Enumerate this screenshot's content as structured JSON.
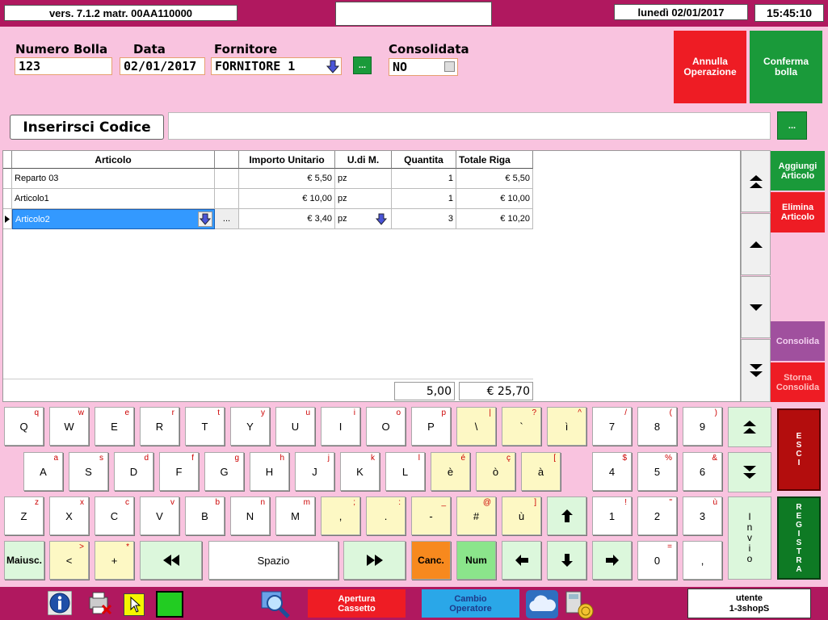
{
  "top": {
    "version": "vers. 7.1.2 matr. 00AA110000",
    "date": "lunedì 02/01/2017",
    "time": "15:45:10"
  },
  "form": {
    "numero_label": "Numero Bolla",
    "numero_value": "123",
    "data_label": "Data",
    "data_value": "02/01/2017",
    "fornitore_label": "Fornitore",
    "fornitore_value": "FORNITORE 1",
    "dots": "...",
    "consolidata_label": "Consolidata",
    "consolidata_value": "NO"
  },
  "buttons": {
    "annulla": "Annulla\nOperazione",
    "conferma": "Conferma\nbolla",
    "inserisci": "Inserirsci Codice",
    "aggiungi": "Aggiungi\nArticolo",
    "elimina": "Elimina\nArticolo",
    "consolida": "Consolida",
    "storna": "Storna\nConsolida",
    "esci": "E\nS\nC\nI",
    "registra": "R\nE\nG\nI\nS\nT\nR\nA",
    "invio": "I\nn\nv\ni\no",
    "colors": {
      "green": "#1a9a3a",
      "red": "#ee1c24",
      "purple": "#a0509e",
      "darkred": "#b30d0d",
      "darkgreen": "#0e7a24"
    }
  },
  "table": {
    "headers": [
      "Articolo",
      "",
      "Importo Unitario",
      "U.di M.",
      "Quantita",
      "Totale Riga"
    ],
    "rows": [
      [
        "Reparto 03",
        "",
        "€ 5,50",
        "pz",
        "1",
        "€ 5,50"
      ],
      [
        "Articolo1",
        "",
        "€ 10,00",
        "pz",
        "1",
        "€ 10,00"
      ],
      [
        "Articolo2",
        "...",
        "€ 3,40",
        "pz",
        "3",
        "€ 10,20"
      ]
    ],
    "total_qty": "5,00",
    "total_amount": "€ 25,70"
  },
  "keyboard": {
    "row1": [
      [
        "Q",
        "q"
      ],
      [
        "W",
        "w"
      ],
      [
        "E",
        "e"
      ],
      [
        "R",
        "r"
      ],
      [
        "T",
        "t"
      ],
      [
        "Y",
        "y"
      ],
      [
        "U",
        "u"
      ],
      [
        "I",
        "i"
      ],
      [
        "O",
        "o"
      ],
      [
        "P",
        "p"
      ],
      [
        "\\",
        "|"
      ],
      [
        "`",
        "?"
      ],
      [
        "ì",
        "^"
      ],
      [
        "7",
        "/"
      ],
      [
        "8",
        "("
      ],
      [
        "9",
        ")"
      ]
    ],
    "row2": [
      [
        "A",
        "a"
      ],
      [
        "S",
        "s"
      ],
      [
        "D",
        "d"
      ],
      [
        "F",
        "f"
      ],
      [
        "G",
        "g"
      ],
      [
        "H",
        "h"
      ],
      [
        "J",
        "j"
      ],
      [
        "K",
        "k"
      ],
      [
        "L",
        "l"
      ],
      [
        "è",
        "é"
      ],
      [
        "ò",
        "ç"
      ],
      [
        "à",
        "["
      ],
      [
        "4",
        "$"
      ],
      [
        "5",
        "%"
      ],
      [
        "6",
        "&"
      ]
    ],
    "row3": [
      [
        "Z",
        "z"
      ],
      [
        "X",
        "x"
      ],
      [
        "C",
        "c"
      ],
      [
        "V",
        "v"
      ],
      [
        "B",
        "b"
      ],
      [
        "N",
        "n"
      ],
      [
        "M",
        "m"
      ],
      [
        ",",
        ";"
      ],
      [
        ".",
        ":"
      ],
      [
        "-",
        "_"
      ],
      [
        "#",
        "@"
      ],
      [
        "ù",
        "]"
      ],
      [
        "1",
        "!"
      ],
      [
        "2",
        "\""
      ],
      [
        "3",
        "ù"
      ]
    ],
    "row4": {
      "maiusc": "Maiusc.",
      "lt": "<",
      "lt_sub": ">",
      "plus": "+",
      "plus_sub": "*",
      "spazio": "Spazio",
      "canc": "Canc.",
      "num": "Num",
      "zero": "0",
      "zero_sub": "=",
      "comma": ","
    }
  },
  "bottom": {
    "apertura": "Apertura\nCassetto",
    "cambio": "Cambio\nOperatore",
    "utente_label": "utente",
    "utente_value": "1-3shopS"
  }
}
